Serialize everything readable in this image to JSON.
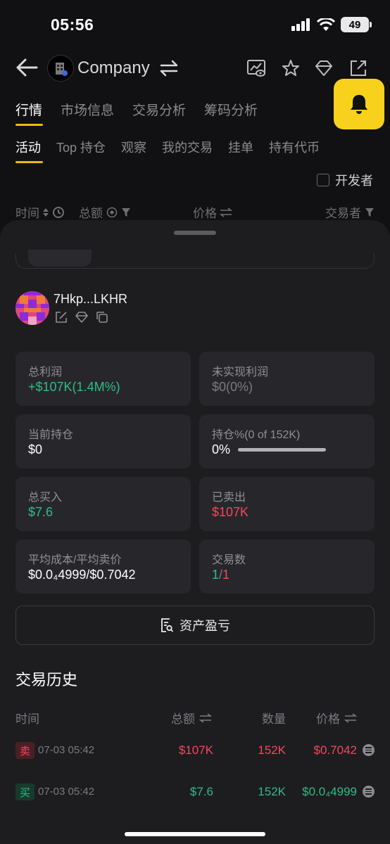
{
  "status_bar": {
    "time": "05:56",
    "battery": "49"
  },
  "header": {
    "token_name": "Company"
  },
  "tabs_primary": [
    "行情",
    "市场信息",
    "交易分析",
    "筹码分析"
  ],
  "tabs_secondary": [
    "活动",
    "Top 持仓",
    "观察",
    "我的交易",
    "挂单",
    "持有代币"
  ],
  "filters": {
    "developer_label": "开发者"
  },
  "columns": {
    "time": "时间",
    "total": "总额",
    "price": "价格",
    "trader": "交易者"
  },
  "wallet": {
    "address": "7Hkp...LKHR"
  },
  "stats": {
    "total_profit_label": "总利润",
    "total_profit_value": "+$107K(1.4M%)",
    "unrealized_label": "未实现利润",
    "unrealized_value": "$0(0%)",
    "holding_label": "当前持仓",
    "holding_value": "$0",
    "holding_pct_label": "持仓%(0 of 152K)",
    "holding_pct_value": "0%",
    "holding_pct_fraction": 0,
    "total_buy_label": "总买入",
    "total_buy_value": "$7.6",
    "sold_label": "已卖出",
    "sold_value": "$107K",
    "avg_label": "平均成本/平均卖价",
    "avg_value": "$0.0₄4999/$0.7042",
    "trades_label": "交易数",
    "trades_buys": "1",
    "trades_sep": "/",
    "trades_sells": "1"
  },
  "pnl_button": "资产盈亏",
  "history": {
    "title": "交易历史",
    "headers": {
      "time": "时间",
      "total": "总额",
      "quantity": "数量",
      "price": "价格"
    },
    "rows": [
      {
        "side": "卖",
        "date": "07-03 05:42",
        "amount": "$107K",
        "qty": "152K",
        "price": "$0.7042"
      },
      {
        "side": "买",
        "date": "07-03 05:42",
        "amount": "$7.6",
        "qty": "152K",
        "price": "$0.0₄4999"
      }
    ]
  },
  "colors": {
    "accent": "#f0b90b",
    "bell": "#f7d11b",
    "green": "#2ebd85",
    "red": "#f6465d"
  },
  "icons": [
    "back-arrow-icon",
    "swap-icon",
    "chart-eye-icon",
    "star-icon",
    "diamond-icon",
    "share-icon",
    "bell-icon",
    "sort-icon",
    "clock-icon",
    "filter-icon",
    "edit-icon",
    "copy-icon",
    "report-icon",
    "more-icon"
  ]
}
